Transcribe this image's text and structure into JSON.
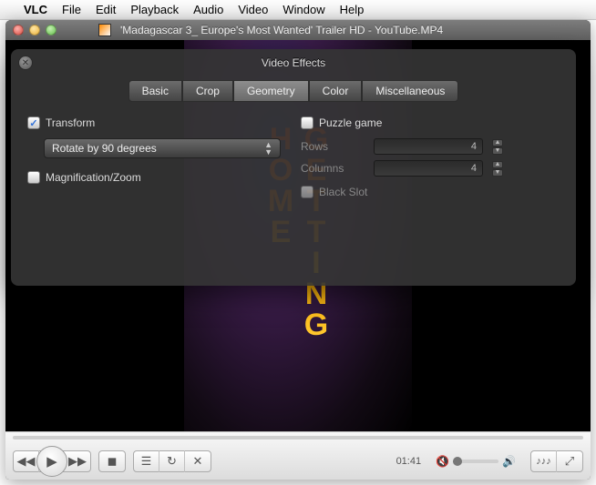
{
  "menubar": {
    "app": "VLC",
    "items": [
      "File",
      "Edit",
      "Playback",
      "Audio",
      "Video",
      "Window",
      "Help"
    ]
  },
  "window": {
    "title": "'Madagascar 3_ Europe's Most Wanted' Trailer HD - YouTube.MP4"
  },
  "video_overlay_text": "GETTING HOME",
  "controls": {
    "time": "01:41"
  },
  "effects": {
    "title": "Video Effects",
    "tabs": [
      "Basic",
      "Crop",
      "Geometry",
      "Color",
      "Miscellaneous"
    ],
    "active_tab": "Geometry",
    "transform": {
      "label": "Transform",
      "checked": true,
      "select_value": "Rotate by 90 degrees"
    },
    "magnify": {
      "label": "Magnification/Zoom",
      "checked": false
    },
    "puzzle": {
      "label": "Puzzle game",
      "checked": false,
      "rows_label": "Rows",
      "rows_value": "4",
      "cols_label": "Columns",
      "cols_value": "4",
      "blackslot_label": "Black Slot",
      "blackslot_checked": false
    }
  }
}
